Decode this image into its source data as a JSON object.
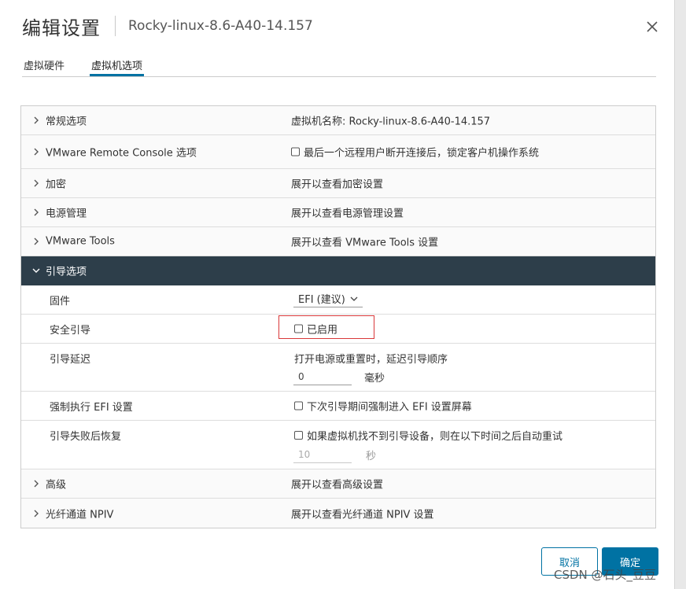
{
  "dialog": {
    "title": "编辑设置",
    "vm_name": "Rocky-linux-8.6-A40-14.157"
  },
  "tabs": [
    {
      "label": "虚拟硬件",
      "active": false
    },
    {
      "label": "虚拟机选项",
      "active": true
    }
  ],
  "sections": {
    "general": {
      "label": "常规选项",
      "value": "虚拟机名称: Rocky-linux-8.6-A40-14.157"
    },
    "vmrc": {
      "label": "VMware Remote Console 选项",
      "value": "最后一个远程用户断开连接后，锁定客户机操作系统",
      "checked": false
    },
    "encryption": {
      "label": "加密",
      "value": "展开以查看加密设置"
    },
    "power": {
      "label": "电源管理",
      "value": "展开以查看电源管理设置"
    },
    "tools": {
      "label": "VMware Tools",
      "value": "展开以查看 VMware Tools 设置"
    },
    "boot": {
      "label": "引导选项",
      "firmware": {
        "label": "固件",
        "value": "EFI (建议)"
      },
      "secure_boot": {
        "label": "安全引导",
        "value": "已启用",
        "checked": false
      },
      "boot_delay": {
        "label": "引导延迟",
        "description": "打开电源或重置时，延迟引导顺序",
        "value": "0",
        "unit": "毫秒"
      },
      "force_efi": {
        "label": "强制执行 EFI 设置",
        "value": "下次引导期间强制进入 EFI 设置屏幕",
        "checked": false
      },
      "failed_boot": {
        "label": "引导失败后恢复",
        "value": "如果虚拟机找不到引导设备，则在以下时间之后自动重试",
        "checked": false,
        "retry_value": "10",
        "unit": "秒"
      }
    },
    "advanced": {
      "label": "高级",
      "value": "展开以查看高级设置"
    },
    "npiv": {
      "label": "光纤通道 NPIV",
      "value": "展开以查看光纤通道 NPIV 设置"
    }
  },
  "buttons": {
    "cancel": "取消",
    "ok": "确定"
  },
  "watermark": "CSDN @石头_豆豆",
  "colors": {
    "accent": "#0072a3",
    "expanded_header": "#2d3e4a",
    "highlight": "#d9383a"
  }
}
